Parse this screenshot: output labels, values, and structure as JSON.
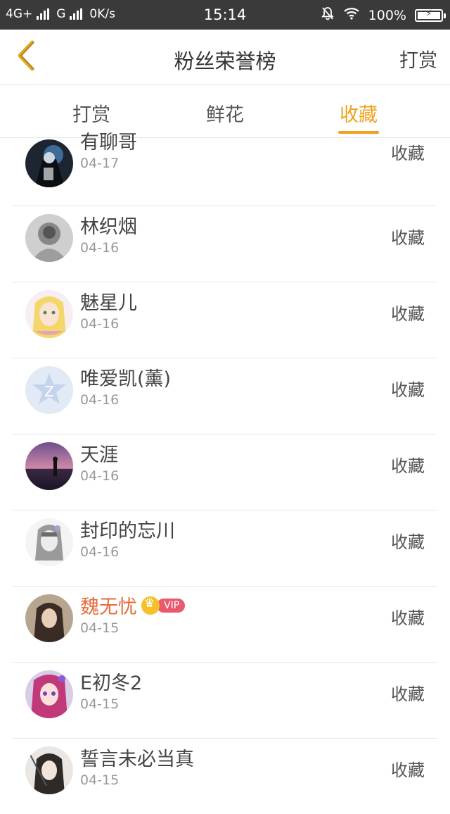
{
  "status": {
    "network1": "4G+",
    "network2": "G",
    "speed": "0K/s",
    "time": "15:14",
    "battery": "100%"
  },
  "nav": {
    "title": "粉丝荣誉榜",
    "right": "打赏"
  },
  "tabs": [
    {
      "label": "打赏",
      "active": false
    },
    {
      "label": "鲜花",
      "active": false
    },
    {
      "label": "收藏",
      "active": true
    }
  ],
  "accent": "#f0a21e",
  "list": [
    {
      "name": "有聊哥",
      "date": "04-17",
      "action": "收藏",
      "avatar": "dark-figure"
    },
    {
      "name": "林织烟",
      "date": "04-16",
      "action": "收藏",
      "avatar": "gray-sketch"
    },
    {
      "name": "魅星儿",
      "date": "04-16",
      "action": "收藏",
      "avatar": "anime-blonde"
    },
    {
      "name": "唯爱凯(薰)",
      "date": "04-16",
      "action": "收藏",
      "avatar": "qq-default"
    },
    {
      "name": "天涯",
      "date": "04-16",
      "action": "收藏",
      "avatar": "sunset-silhouette"
    },
    {
      "name": "封印的忘川",
      "date": "04-16",
      "action": "收藏",
      "avatar": "anime-gray"
    },
    {
      "name": "魏无忧",
      "date": "04-15",
      "action": "收藏",
      "avatar": "girl-photo",
      "vip": "VIP"
    },
    {
      "name": "E初冬2",
      "date": "04-15",
      "action": "收藏",
      "avatar": "anime-pink"
    },
    {
      "name": "誓言未必当真",
      "date": "04-15",
      "action": "收藏",
      "avatar": "anime-dark"
    }
  ]
}
